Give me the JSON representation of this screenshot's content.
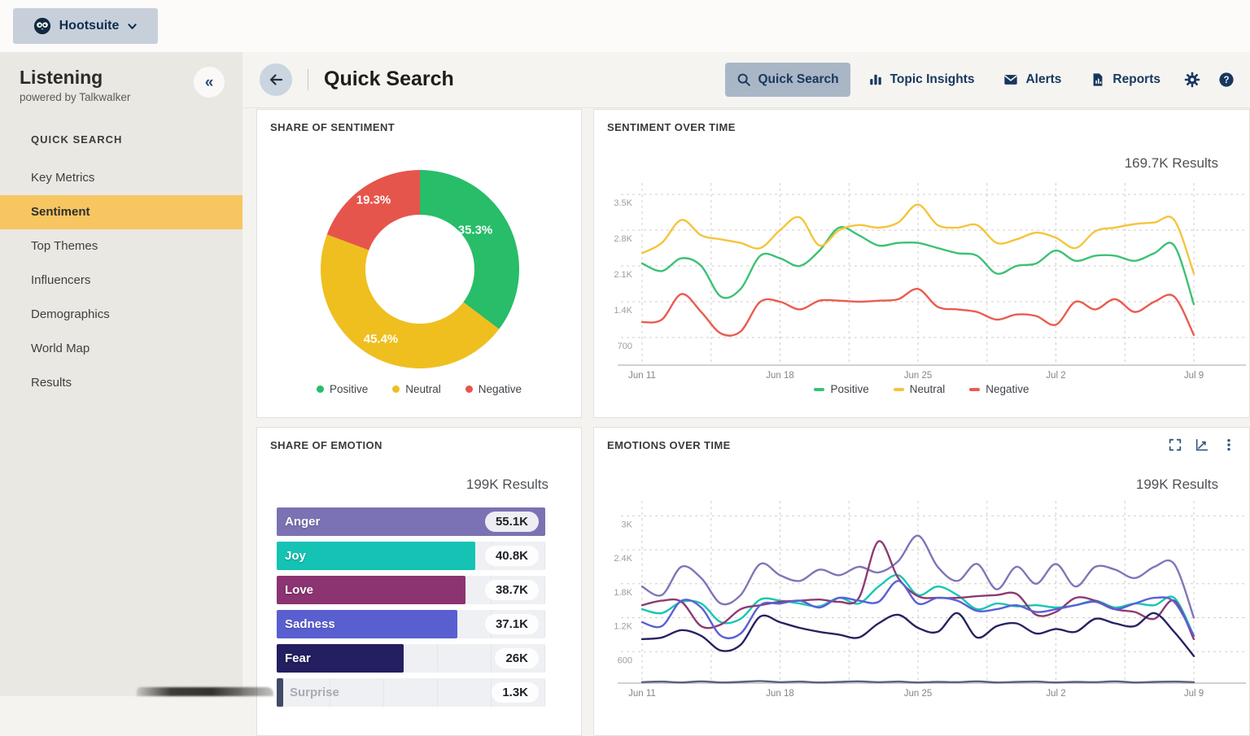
{
  "topbar": {
    "brand": "Hootsuite"
  },
  "sidebar": {
    "title": "Listening",
    "subtitle": "powered by Talkwalker",
    "section_label": "QUICK SEARCH",
    "active_bg": "#f8c661",
    "items": [
      {
        "label": "Key Metrics",
        "active": false
      },
      {
        "label": "Sentiment",
        "active": true
      },
      {
        "label": "Top Themes",
        "active": false
      },
      {
        "label": "Influencers",
        "active": false
      },
      {
        "label": "Demographics",
        "active": false
      },
      {
        "label": "World Map",
        "active": false
      },
      {
        "label": "Results",
        "active": false
      }
    ]
  },
  "header": {
    "title": "Quick Search",
    "nav": [
      {
        "label": "Quick Search",
        "icon": "search-icon",
        "active": true
      },
      {
        "label": "Topic Insights",
        "icon": "bar-chart-icon",
        "active": false
      },
      {
        "label": "Alerts",
        "icon": "envelope-icon",
        "active": false
      },
      {
        "label": "Reports",
        "icon": "report-icon",
        "active": false
      }
    ],
    "action_icons": [
      "settings-gear-icon",
      "help-icon"
    ]
  },
  "panels": {
    "share_of_sentiment": {
      "title": "SHARE OF SENTIMENT",
      "chart_data": {
        "type": "pie",
        "donut": true,
        "legend_position": "bottom",
        "slices": [
          {
            "label": "Positive",
            "value_pct": 35.3,
            "display": "35.3%",
            "color": "#27bd69"
          },
          {
            "label": "Neutral",
            "value_pct": 45.4,
            "display": "45.4%",
            "color": "#efbf1f"
          },
          {
            "label": "Negative",
            "value_pct": 19.3,
            "display": "19.3%",
            "color": "#e6554c"
          }
        ]
      }
    },
    "sentiment_over_time": {
      "title": "SENTIMENT OVER TIME",
      "results": "169.7K Results",
      "chart_data": {
        "type": "line",
        "grid": "dashed",
        "legend_position": "bottom",
        "ylim": [
          0,
          3850
        ],
        "y_tick_values": [
          700,
          1400,
          2100,
          2800,
          3500
        ],
        "y_tick_labels": [
          "700",
          "1.4K",
          "2.1K",
          "2.8K",
          "3.5K"
        ],
        "x_tick_labels": [
          "Jun 11",
          "Jun 18",
          "Jun 25",
          "Jul 2",
          "Jul 9"
        ],
        "x_tick_days": [
          0,
          7,
          14,
          21,
          28
        ],
        "series": [
          {
            "name": "Positive",
            "color": "#3cc174",
            "values": [
              2150,
              2000,
              2250,
              2100,
              1500,
              1650,
              2300,
              2250,
              2100,
              2400,
              2850,
              2700,
              2500,
              2550,
              2550,
              2450,
              2350,
              2300,
              1950,
              2100,
              2150,
              2400,
              2200,
              2300,
              2300,
              2200,
              2350,
              2500,
              1350
            ]
          },
          {
            "name": "Neutral",
            "color": "#f5c43c",
            "values": [
              2350,
              2550,
              3000,
              2700,
              2620,
              2550,
              2450,
              2800,
              3050,
              2500,
              2800,
              2900,
              2850,
              2950,
              3300,
              2900,
              2850,
              2900,
              2550,
              2620,
              2750,
              2650,
              2450,
              2780,
              2850,
              2920,
              2950,
              3000,
              1950
            ]
          },
          {
            "name": "Negative",
            "color": "#ea5c50",
            "values": [
              1000,
              1050,
              1550,
              1200,
              780,
              820,
              1400,
              1400,
              1250,
              1420,
              1420,
              1400,
              1420,
              1450,
              1650,
              1300,
              1250,
              1200,
              1050,
              1150,
              1120,
              950,
              1400,
              1250,
              1450,
              1200,
              1400,
              1500,
              750
            ]
          }
        ]
      }
    },
    "share_of_emotion": {
      "title": "SHARE OF EMOTION",
      "results": "199K Results",
      "chart_data": {
        "type": "bar",
        "orientation": "horizontal",
        "xmax": 55100,
        "categories": [
          "Anger",
          "Joy",
          "Love",
          "Sadness",
          "Fear",
          "Surprise"
        ],
        "values": [
          55100,
          40800,
          38700,
          37100,
          26000,
          1300
        ],
        "value_labels": [
          "55.1K",
          "40.8K",
          "38.7K",
          "37.1K",
          "26K",
          "1.3K"
        ],
        "colors": [
          "#7b72b3",
          "#14c3b4",
          "#8c3371",
          "#5a5fd0",
          "#231f60",
          "#424a68"
        ]
      }
    },
    "emotions_over_time": {
      "title": "EMOTIONS OVER TIME",
      "results": "199K Results",
      "toolbar_icons": [
        "fullscreen-icon",
        "line-chart-icon",
        "kebab-menu-icon"
      ],
      "chart_data": {
        "type": "line",
        "grid": "dashed",
        "ylim": [
          0,
          3300
        ],
        "y_tick_values": [
          600,
          1200,
          1800,
          2400,
          3000
        ],
        "y_tick_labels": [
          "600",
          "1.2K",
          "1.8K",
          "2.4K",
          "3K"
        ],
        "x_tick_labels": [
          "Jun 11",
          "Jun 18",
          "Jun 25",
          "Jul 2",
          "Jul 9"
        ],
        "x_tick_days": [
          0,
          7,
          14,
          21,
          28
        ],
        "series": [
          {
            "name": "Anger",
            "color": "#7e76b8",
            "values": [
              1750,
              1600,
              2100,
              1900,
              1450,
              1600,
              2150,
              1950,
              1850,
              2050,
              1950,
              2100,
              2000,
              2200,
              2650,
              2100,
              1850,
              2150,
              1700,
              2100,
              1800,
              2150,
              1750,
              2100,
              2050,
              1900,
              2100,
              2150,
              1200
            ]
          },
          {
            "name": "Joy",
            "color": "#17c6b2",
            "values": [
              1350,
              1280,
              1480,
              1450,
              1120,
              1180,
              1520,
              1500,
              1450,
              1400,
              1550,
              1450,
              1750,
              1950,
              1600,
              1750,
              1600,
              1350,
              1450,
              1400,
              1420,
              1380,
              1420,
              1500,
              1380,
              1450,
              1420,
              1550,
              880
            ]
          },
          {
            "name": "Love",
            "color": "#8d3a74",
            "values": [
              1420,
              1500,
              1480,
              1050,
              1080,
              1350,
              1420,
              1480,
              1500,
              1520,
              1480,
              1550,
              2550,
              1900,
              1580,
              1550,
              1550,
              1580,
              1600,
              1620,
              1250,
              1300,
              1550,
              1500,
              1350,
              1300,
              1180,
              1500,
              820
            ]
          },
          {
            "name": "Sadness",
            "color": "#5a60d4",
            "values": [
              1120,
              1050,
              1500,
              1380,
              880,
              920,
              1420,
              1450,
              1500,
              1380,
              1550,
              1500,
              1480,
              1850,
              1450,
              1550,
              1500,
              1320,
              1350,
              1420,
              1300,
              1350,
              1420,
              1480,
              1350,
              1450,
              1550,
              1480,
              880
            ]
          },
          {
            "name": "Fear",
            "color": "#262262",
            "values": [
              820,
              850,
              980,
              880,
              620,
              720,
              1220,
              1120,
              1020,
              950,
              900,
              850,
              1100,
              1250,
              1020,
              950,
              1280,
              850,
              1050,
              1100,
              920,
              1000,
              950,
              1180,
              1100,
              1050,
              1280,
              950,
              520
            ]
          },
          {
            "name": "Surprise",
            "color": "#5a6280",
            "values": [
              60,
              70,
              55,
              75,
              55,
              65,
              80,
              60,
              70,
              55,
              65,
              75,
              60,
              70,
              55,
              65,
              60,
              75,
              55,
              65,
              70,
              55,
              65,
              60,
              75,
              55,
              65,
              70,
              60
            ]
          }
        ]
      }
    }
  }
}
